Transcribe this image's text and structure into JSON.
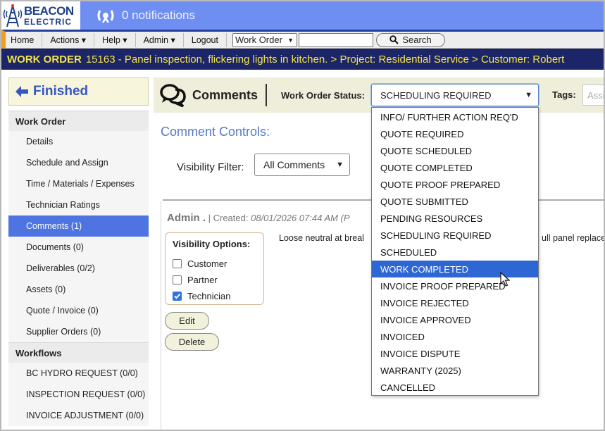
{
  "logo": {
    "line1": "BEACON",
    "line2": "ELECTRIC"
  },
  "notifications": {
    "text": "0 notifications"
  },
  "nav": {
    "items": [
      "Home",
      "Actions ▾",
      "Help ▾",
      "Admin ▾",
      "Logout"
    ],
    "select_value": "Work Order",
    "search_label": "Search",
    "search_value": ""
  },
  "titlebar": {
    "label": "WORK ORDER",
    "text": "15163 - Panel inspection, flickering lights in kitchen. > Project: Residential Service > Customer: Robert"
  },
  "sidebar": {
    "finished_label": "Finished",
    "section1": "Work Order",
    "items": [
      "Details",
      "Schedule and Assign",
      "Time / Materials / Expenses",
      "Technician Ratings",
      "Comments (1)",
      "Documents (0)",
      "Deliverables (0/2)",
      "Assets (0)",
      "Quote / Invoice (0)",
      "Supplier Orders (0)"
    ],
    "active_index": 4,
    "section2": "Workflows",
    "workflows": [
      "BC HYDRO REQUEST (0/0)",
      "INSPECTION REQUEST (0/0)",
      "INVOICE ADJUSTMENT (0/0)"
    ]
  },
  "header": {
    "title": "Comments",
    "status_label": "Work Order Status:",
    "status_value": "SCHEDULING REQUIRED",
    "tags_label": "Tags:",
    "tags_placeholder": "Assi"
  },
  "controls": {
    "title": "Comment Controls:",
    "filter_label": "Visibility Filter:",
    "filter_value": "All Comments"
  },
  "comment": {
    "author": "Admin .",
    "created_label": "| Created:",
    "created_date": "08/01/2026 07:44 AM (P",
    "body": "Loose neutral at breal",
    "body_tail": "ull panel replace",
    "visibility_title": "Visibility Options:",
    "visibility": [
      {
        "label": "Customer",
        "checked": false
      },
      {
        "label": "Partner",
        "checked": false
      },
      {
        "label": "Technician",
        "checked": true
      }
    ],
    "edit_label": "Edit",
    "delete_label": "Delete"
  },
  "status_options": [
    "INFO/ FURTHER ACTION REQ'D",
    "QUOTE REQUIRED",
    "QUOTE SCHEDULED",
    "QUOTE COMPLETED",
    "QUOTE PROOF PREPARED",
    "QUOTE SUBMITTED",
    "PENDING RESOURCES",
    "SCHEDULING REQUIRED",
    "SCHEDULED",
    "WORK COMPLETED",
    "INVOICE PROOF PREPARED",
    "INVOICE REJECTED",
    "INVOICE APPROVED",
    "INVOICED",
    "INVOICE DISPUTE",
    "WARRANTY (2025)",
    "CANCELLED"
  ],
  "highlighted_option_index": 9,
  "colors": {
    "topbar": "#6f8ef2",
    "navy": "#1c2567",
    "title_yellow": "#f5e54a",
    "accent_blue": "#4d74e0",
    "highlight": "#2e67d4"
  }
}
